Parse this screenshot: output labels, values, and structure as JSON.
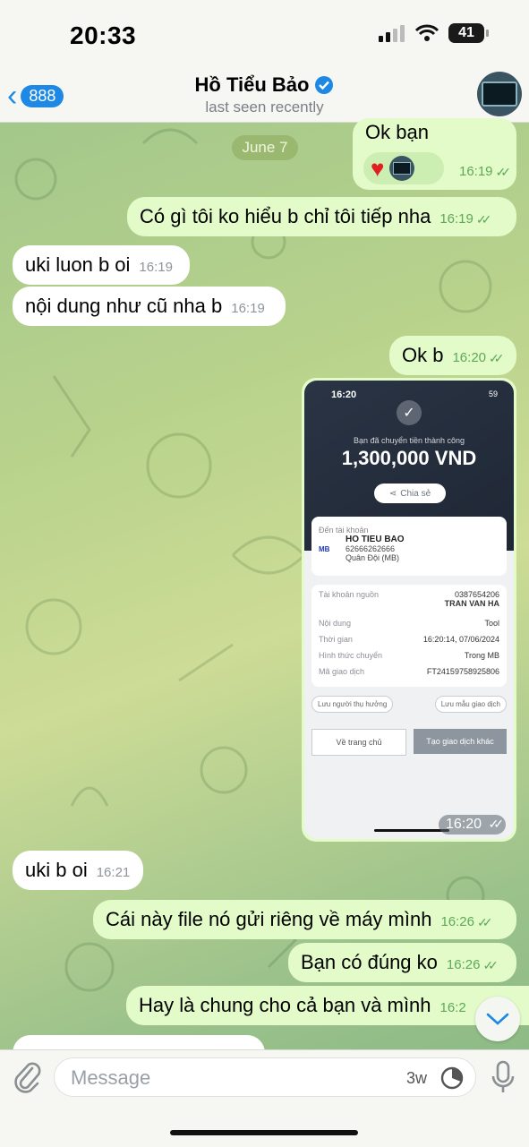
{
  "status_bar": {
    "time": "20:33",
    "battery": "41"
  },
  "header": {
    "back_count": "888",
    "name": "Hồ Tiểu Bảo",
    "subtitle": "last seen recently",
    "back_icon": "chevron-left-icon",
    "verified_icon": "verified-badge-icon"
  },
  "date_chip": "June 7",
  "messages": [
    {
      "dir": "out",
      "text": "Ok bạn",
      "time": "16:19",
      "reactions": [
        "heart",
        "avatar"
      ]
    },
    {
      "dir": "out",
      "text": "Có gì tôi ko hiểu b chỉ tôi tiếp nha",
      "time": "16:19"
    },
    {
      "dir": "in",
      "text": "uki luon b oi",
      "time": "16:19"
    },
    {
      "dir": "in",
      "text": "nội dung như cũ nha b",
      "time": "16:19"
    },
    {
      "dir": "out",
      "text": "Ok b",
      "time": "16:20"
    },
    {
      "dir": "in",
      "text": "uki b oi",
      "time": "16:21"
    },
    {
      "dir": "out",
      "text": "Cái này file nó gửi riêng về máy mình",
      "time": "16:26"
    },
    {
      "dir": "out",
      "text": "Bạn có đúng ko",
      "time": "16:26"
    },
    {
      "dir": "out",
      "text": "Hay là chung cho cả bạn và mình",
      "time": "16:2"
    }
  ],
  "photo": {
    "time": "16:20",
    "receipt": {
      "time": "16:20",
      "battery": "59",
      "success_text": "Bạn đã chuyển tiền thành công",
      "amount": "1,300,000 VND",
      "share_label": "Chia sẻ",
      "to_account_label": "Đến tài khoản",
      "recipient_name": "HO TIEU BAO",
      "recipient_account": "62666262666",
      "recipient_bank": "Quân Đội (MB)",
      "bank_logo": "MB",
      "rows": [
        {
          "k": "Tài khoản nguồn",
          "v": "0387654206",
          "v2": "TRAN VAN HA"
        },
        {
          "k": "Nội dung",
          "v": "Tool"
        },
        {
          "k": "Thời gian",
          "v": "16:20:14, 07/06/2024"
        },
        {
          "k": "Hình thức chuyển",
          "v": "Trong MB"
        },
        {
          "k": "Mã giao dịch",
          "v": "FT24159758925806"
        }
      ],
      "save_recipient": "Lưu người thụ hưởng",
      "save_template": "Lưu mẫu giao dịch",
      "home_button": "Về trang chủ",
      "new_transaction_button": "Tạo giao dịch khác"
    }
  },
  "composer": {
    "placeholder": "Message",
    "timer_label": "3w",
    "attach_icon": "paperclip-icon",
    "timer_icon": "self-destruct-timer-icon",
    "mic_icon": "microphone-icon"
  },
  "colors": {
    "outgoing_bubble": "#e2fbc8",
    "incoming_bubble": "#ffffff",
    "accent": "#1e88e5",
    "tick_green": "#5fa85a"
  }
}
